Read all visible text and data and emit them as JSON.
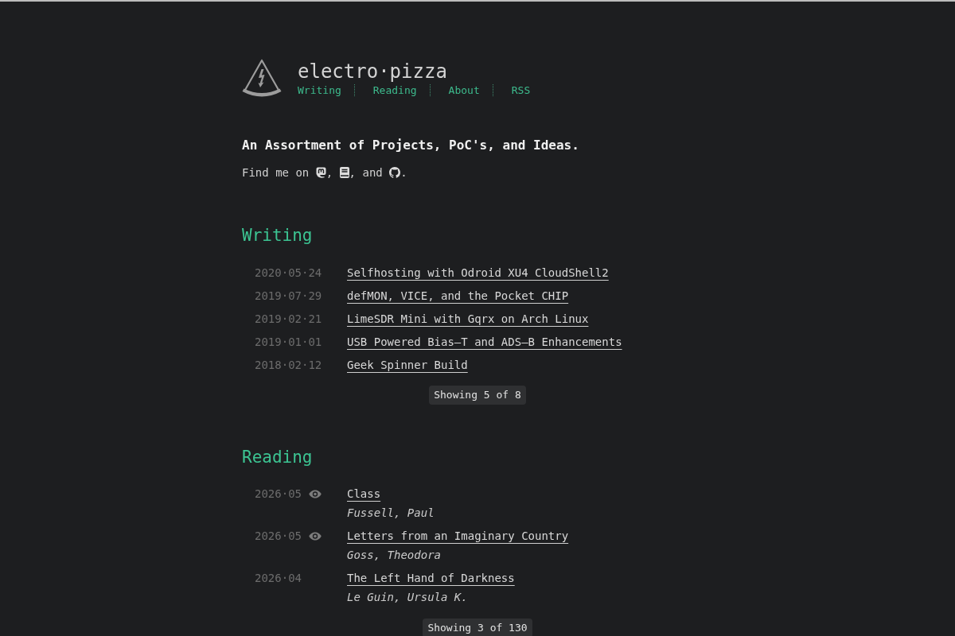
{
  "site": {
    "title": "electro·pizza",
    "nav": [
      "Writing",
      "Reading",
      "About",
      "RSS"
    ]
  },
  "intro": {
    "tagline": "An Assortment of Projects, PoC's, and Ideas.",
    "find_me": {
      "text": "Find me on",
      "links": [
        {
          "kind": "mastodon",
          "after": ","
        },
        {
          "kind": "book",
          "after": ", and"
        },
        {
          "kind": "github",
          "after": "."
        }
      ]
    }
  },
  "writing": {
    "heading": "Writing",
    "posts": [
      {
        "date": "2020·05·24",
        "title": "Selfhosting with Odroid XU4 CloudShell2"
      },
      {
        "date": "2019·07·29",
        "title": "defMON, VICE, and the Pocket CHIP"
      },
      {
        "date": "2019·02·21",
        "title": "LimeSDR Mini with Gqrx on Arch Linux"
      },
      {
        "date": "2019·01·01",
        "title": "USB Powered Bias–T and ADS–B Enhancements"
      },
      {
        "date": "2018·02·12",
        "title": "Geek Spinner Build"
      }
    ],
    "count": "Showing 5 of 8"
  },
  "reading": {
    "heading": "Reading",
    "books": [
      {
        "date": "2026·05",
        "currently_reading": true,
        "title": "Class",
        "author": "Fussell, Paul"
      },
      {
        "date": "2026·05",
        "currently_reading": true,
        "title": "Letters from an Imaginary Country",
        "author": "Goss, Theodora"
      },
      {
        "date": "2026·04",
        "currently_reading": false,
        "title": "The Left Hand of Darkness",
        "author": "Le Guin, Ursula K."
      }
    ],
    "count": "Showing 3 of 130"
  }
}
